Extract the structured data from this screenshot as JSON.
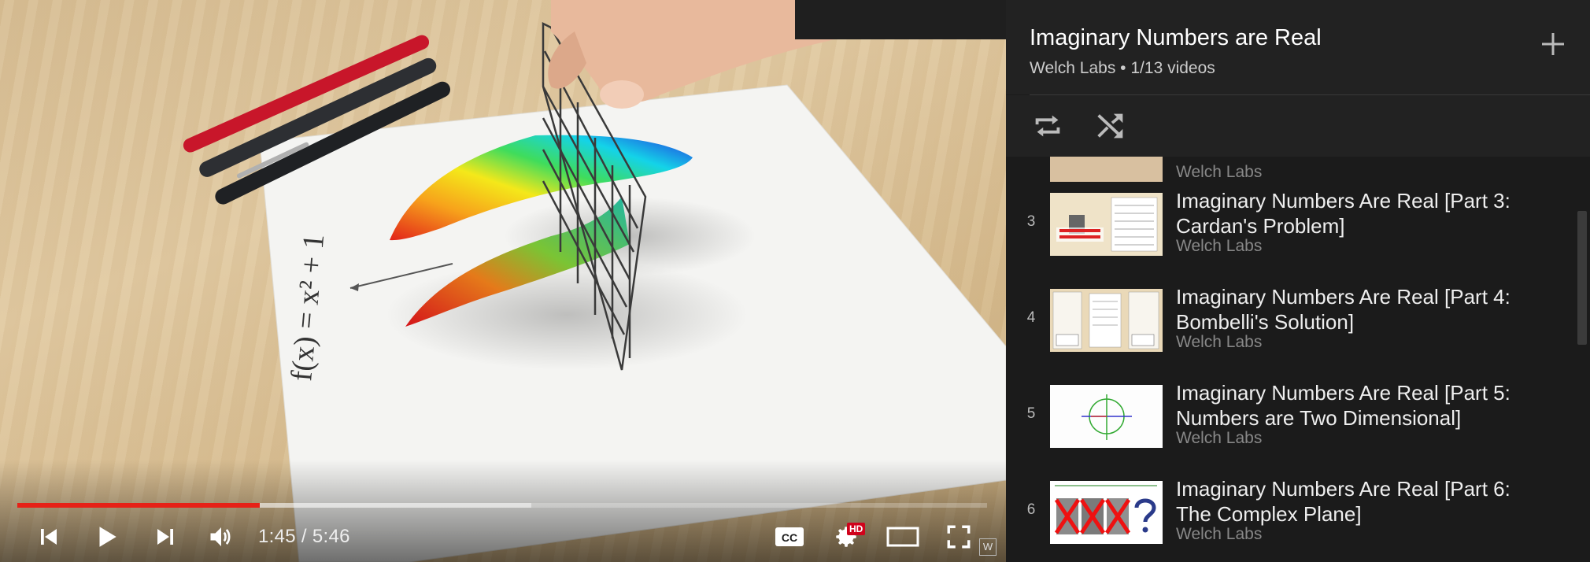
{
  "player": {
    "time": {
      "current": "1:45",
      "separator": " / ",
      "duration": "5:46"
    },
    "progress": {
      "played_fraction": 0.25,
      "buffered_fraction": 0.42
    },
    "hd_badge": "HD",
    "watermark": "W",
    "paper_equation": "f(x) = x² + 1",
    "accent_color": "#e62117"
  },
  "playlist": {
    "title": "Imaginary Numbers are Real",
    "channel": "Welch Labs",
    "separator": " • ",
    "position": "1/13 videos",
    "partial_item_channel": "Welch Labs",
    "items": [
      {
        "index": "3",
        "title": "Imaginary Numbers Are Real [Part 3: Cardan's Problem]",
        "channel": "Welch Labs"
      },
      {
        "index": "4",
        "title": "Imaginary Numbers Are Real [Part 4: Bombelli's Solution]",
        "channel": "Welch Labs"
      },
      {
        "index": "5",
        "title": "Imaginary Numbers Are Real [Part 5: Numbers are Two Dimensional]",
        "channel": "Welch Labs"
      },
      {
        "index": "6",
        "title": "Imaginary Numbers Are Real [Part 6: The Complex Plane]",
        "channel": "Welch Labs"
      }
    ]
  },
  "icons": {
    "prev": "skip-previous-icon",
    "play": "play-icon",
    "next": "skip-next-icon",
    "volume": "volume-icon",
    "captions": "closed-captions-icon",
    "settings": "gear-icon",
    "theater": "theater-mode-icon",
    "fullscreen": "fullscreen-icon",
    "add": "plus-icon",
    "loop": "loop-icon",
    "shuffle": "shuffle-icon"
  }
}
